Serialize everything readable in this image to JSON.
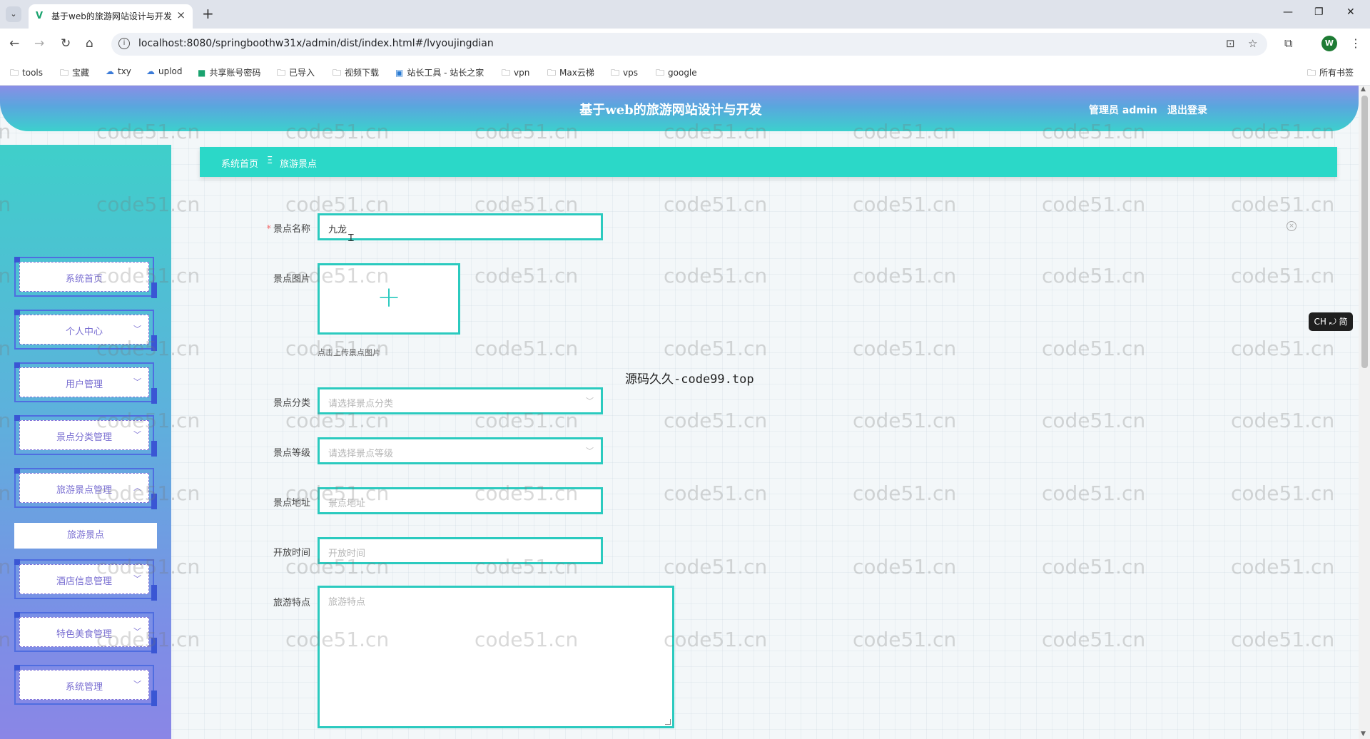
{
  "browser": {
    "tab_title": "基于web的旅游网站设计与开发",
    "url": "localhost:8080/springboothw31x/admin/dist/index.html#/lvyoujingdian",
    "profile_initial": "W",
    "bookmarks": [
      {
        "icon": "folder-icon",
        "label": "tools"
      },
      {
        "icon": "folder-icon",
        "label": "宝藏"
      },
      {
        "icon": "cloud-icon",
        "label": "txy"
      },
      {
        "icon": "cloud-icon",
        "label": "uplod"
      },
      {
        "icon": "site-icon",
        "label": "共享账号密码"
      },
      {
        "icon": "folder-icon",
        "label": "已导入"
      },
      {
        "icon": "folder-icon",
        "label": "视频下载"
      },
      {
        "icon": "site-icon",
        "label": "站长工具 - 站长之家"
      },
      {
        "icon": "folder-icon",
        "label": "vpn"
      },
      {
        "icon": "folder-icon",
        "label": "Max云梯"
      },
      {
        "icon": "folder-icon",
        "label": "vps"
      },
      {
        "icon": "folder-icon",
        "label": "google"
      }
    ],
    "all_bookmarks": "所有书签"
  },
  "header": {
    "title": "基于web的旅游网站设计与开发",
    "user": "管理员 admin",
    "logout": "退出登录"
  },
  "sidebar": {
    "items": [
      {
        "label": "系统首页",
        "has_chevron": false
      },
      {
        "label": "个人中心",
        "has_chevron": true
      },
      {
        "label": "用户管理",
        "has_chevron": true
      },
      {
        "label": "景点分类管理",
        "has_chevron": true
      },
      {
        "label": "旅游景点管理",
        "has_chevron": true,
        "expanded": true
      },
      {
        "label": "酒店信息管理",
        "has_chevron": true
      },
      {
        "label": "特色美食管理",
        "has_chevron": true
      },
      {
        "label": "系统管理",
        "has_chevron": true
      }
    ],
    "submenu": {
      "label": "旅游景点"
    }
  },
  "breadcrumb": {
    "home": "系统首页",
    "separator": "Ξ",
    "current": "旅游景点"
  },
  "form": {
    "name": {
      "label": "景点名称",
      "required": true,
      "value": "九龙"
    },
    "image": {
      "label": "景点图片",
      "hint": "点击上传景点图片"
    },
    "category": {
      "label": "景点分类",
      "placeholder": "请选择景点分类"
    },
    "level": {
      "label": "景点等级",
      "placeholder": "请选择景点等级"
    },
    "address": {
      "label": "景点地址",
      "placeholder": "景点地址"
    },
    "open_time": {
      "label": "开放时间",
      "placeholder": "开放时间"
    },
    "features": {
      "label": "旅游特点",
      "placeholder": "旅游特点"
    }
  },
  "overlay": {
    "center_note": "源码久久-code99.top",
    "ime_badge": "CH ⤾ 简",
    "watermark": "code51.cn"
  }
}
